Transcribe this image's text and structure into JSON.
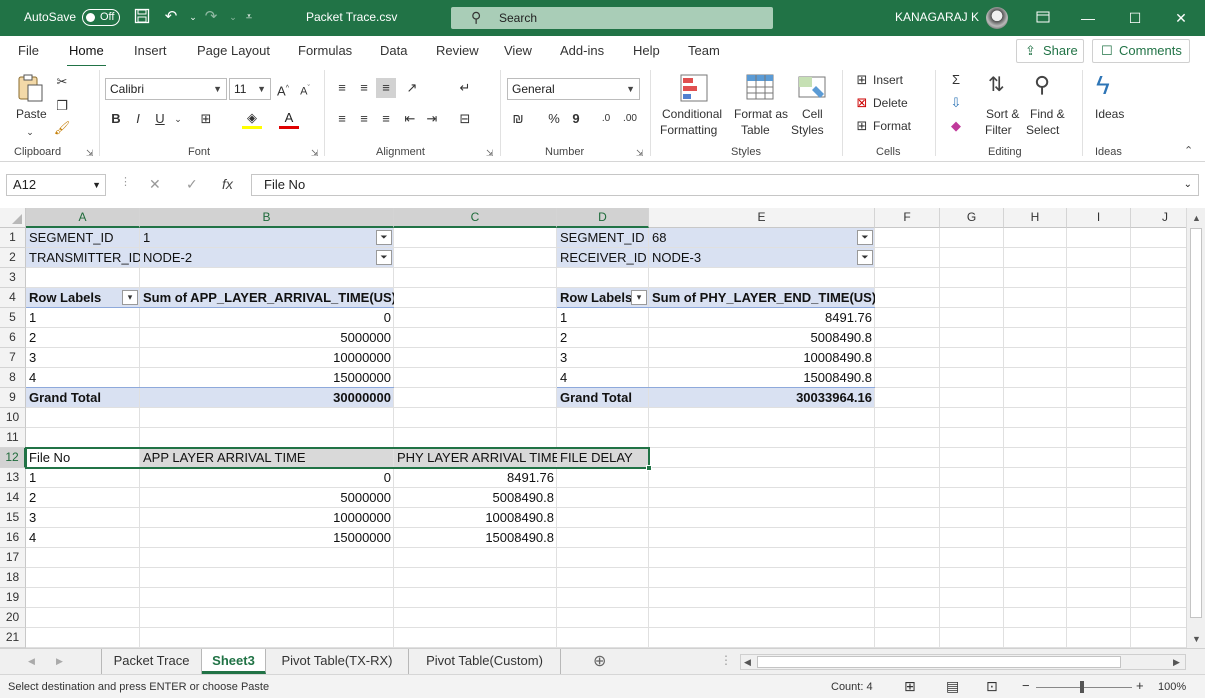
{
  "titlebar": {
    "autosave_label": "AutoSave",
    "autosave_state": "Off",
    "file_title": "Packet Trace.csv",
    "search_placeholder": "Search",
    "user_name": "KANAGARAJ K"
  },
  "tabs": [
    "File",
    "Home",
    "Insert",
    "Page Layout",
    "Formulas",
    "Data",
    "Review",
    "View",
    "Add-ins",
    "Help",
    "Team"
  ],
  "active_tab": "Home",
  "share_label": "Share",
  "comments_label": "Comments",
  "ribbon": {
    "clipboard": {
      "paste_label": "Paste",
      "group_label": "Clipboard"
    },
    "font": {
      "font_name": "Calibri",
      "font_size": "11",
      "group_label": "Font",
      "bold": "B",
      "italic": "I",
      "underline": "U"
    },
    "alignment": {
      "group_label": "Alignment"
    },
    "number": {
      "format": "General",
      "group_label": "Number"
    },
    "styles": {
      "conditional_1": "Conditional",
      "conditional_2": "Formatting",
      "format_as_1": "Format as",
      "format_as_2": "Table",
      "cell_1": "Cell",
      "cell_2": "Styles",
      "group_label": "Styles"
    },
    "cells": {
      "insert": "Insert",
      "delete": "Delete",
      "format": "Format",
      "group_label": "Cells"
    },
    "editing": {
      "sort_1": "Sort &",
      "sort_2": "Filter",
      "find_1": "Find &",
      "find_2": "Select",
      "group_label": "Editing"
    },
    "ideas": {
      "label": "Ideas",
      "group_label": "Ideas"
    }
  },
  "formula_bar": {
    "name_box": "A12",
    "formula": "File No"
  },
  "columns": [
    "A",
    "B",
    "C",
    "D",
    "E",
    "F",
    "G",
    "H",
    "I",
    "J"
  ],
  "rows": [
    "1",
    "2",
    "3",
    "4",
    "5",
    "6",
    "7",
    "8",
    "9",
    "10",
    "11",
    "12",
    "13",
    "14",
    "15",
    "16",
    "17",
    "18",
    "19",
    "20",
    "21"
  ],
  "pivot_left": {
    "filter1_label": "SEGMENT_ID",
    "filter1_value": "1",
    "filter2_label": "TRANSMITTER_ID",
    "filter2_value": "NODE-2",
    "row_labels": "Row Labels",
    "value_header": "Sum of APP_LAYER_ARRIVAL_TIME(US)",
    "rows": [
      [
        "1",
        "0"
      ],
      [
        "2",
        "5000000"
      ],
      [
        "3",
        "10000000"
      ],
      [
        "4",
        "15000000"
      ]
    ],
    "grand_total_label": "Grand Total",
    "grand_total_value": "30000000"
  },
  "pivot_right": {
    "filter1_label": "SEGMENT_ID",
    "filter1_value": "68",
    "filter2_label": "RECEIVER_ID",
    "filter2_value": "NODE-3",
    "row_labels": "Row Labels",
    "value_header": "Sum of PHY_LAYER_END_TIME(US)",
    "rows": [
      [
        "1",
        "8491.76"
      ],
      [
        "2",
        "5008490.8"
      ],
      [
        "3",
        "10008490.8"
      ],
      [
        "4",
        "15008490.8"
      ]
    ],
    "grand_total_label": "Grand Total",
    "grand_total_value": "30033964.16"
  },
  "table": {
    "headers": [
      "File No",
      "APP LAYER ARRIVAL TIME",
      "PHY LAYER ARRIVAL TIME",
      "FILE DELAY"
    ],
    "rows": [
      [
        "1",
        "0",
        "8491.76"
      ],
      [
        "2",
        "5000000",
        "5008490.8"
      ],
      [
        "3",
        "10000000",
        "10008490.8"
      ],
      [
        "4",
        "15000000",
        "15008490.8"
      ]
    ]
  },
  "sheets": [
    "Packet Trace",
    "Sheet3",
    "Pivot Table(TX-RX)",
    "Pivot Table(Custom)"
  ],
  "active_sheet": "Sheet3",
  "status": {
    "message": "Select destination and press ENTER or choose Paste",
    "count": "Count: 4",
    "zoom": "100%"
  },
  "colors": {
    "excel_green": "#217346",
    "pivot_fill": "#d9e1f2",
    "header_fill": "#d9d9d9"
  }
}
